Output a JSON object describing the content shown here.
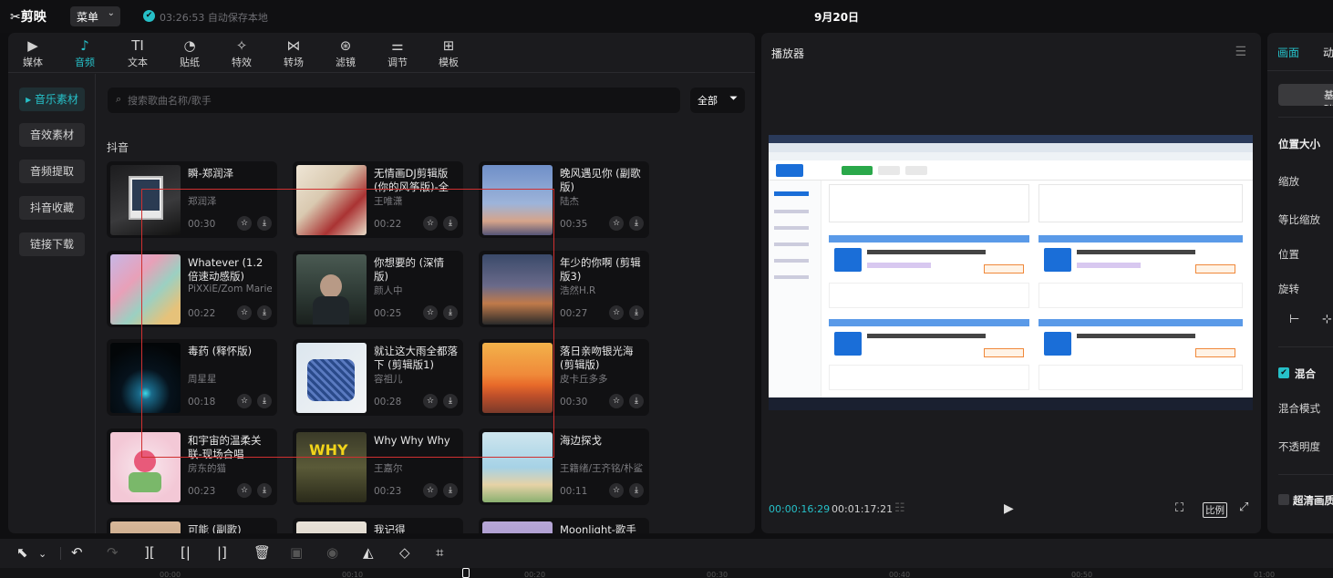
{
  "app": {
    "logo": "✂剪映",
    "menu_label": "菜单",
    "save_icon": "✔",
    "save_status": "03:26:53 自动保存本地",
    "project_title": "9月20日"
  },
  "media_tabs": [
    {
      "icon": "▶",
      "label": "媒体"
    },
    {
      "icon": "♪",
      "label": "音频"
    },
    {
      "icon": "TI",
      "label": "文本"
    },
    {
      "icon": "◔",
      "label": "贴纸"
    },
    {
      "icon": "✧",
      "label": "特效"
    },
    {
      "icon": "⋈",
      "label": "转场"
    },
    {
      "icon": "⊛",
      "label": "滤镜"
    },
    {
      "icon": "⚌",
      "label": "调节"
    },
    {
      "icon": "⊞",
      "label": "模板"
    }
  ],
  "sidebar": [
    "▸ 音乐素材",
    "音效素材",
    "音频提取",
    "抖音收藏",
    "链接下载"
  ],
  "search": {
    "placeholder": "搜索歌曲名称/歌手",
    "filter_label": "全部"
  },
  "section_title": "抖音",
  "songs": [
    {
      "title": "瞬-郑润泽",
      "artist": "郑润泽",
      "duration": "00:30"
    },
    {
      "title": "无情画DJ剪辑版 (你的风筝版)-全网可听",
      "artist": "王唯潇",
      "duration": "00:22"
    },
    {
      "title": "晚风遇见你 (副歌版)",
      "artist": "陆杰",
      "duration": "00:35"
    },
    {
      "title": "Whatever (1.2倍速动感版)",
      "artist": "PiXXiE/Zom Marie",
      "duration": "00:22"
    },
    {
      "title": "你想要的 (深情版)",
      "artist": "颜人中",
      "duration": "00:25"
    },
    {
      "title": "年少的你啊 (剪辑版3)",
      "artist": "浩然H.R",
      "duration": "00:27"
    },
    {
      "title": "毒药 (释怀版)",
      "artist": "周星星",
      "duration": "00:18"
    },
    {
      "title": "就让这大雨全都落下 (剪辑版1)",
      "artist": "容祖儿",
      "duration": "00:28"
    },
    {
      "title": "落日亲吻银光海(剪辑版)",
      "artist": "皮卡丘多多",
      "duration": "00:30"
    },
    {
      "title": "和宇宙的温柔关联-现场合唱",
      "artist": "房东的猫",
      "duration": "00:23"
    },
    {
      "title": "Why Why Why",
      "artist": "王嘉尔",
      "duration": "00:23"
    },
    {
      "title": "海边探戈",
      "artist": "王籍绪/王齐铭/朴鲨",
      "duration": "00:11"
    },
    {
      "title": "可能 (副歌)",
      "artist": "",
      "duration": ""
    },
    {
      "title": "我记得",
      "artist": "",
      "duration": ""
    },
    {
      "title": "Moonlight-歌手叁",
      "artist": "",
      "duration": ""
    }
  ],
  "player": {
    "title": "播放器",
    "current_time": "00:00:16:29",
    "total_time": "00:01:17:21",
    "ratio_label": "比例"
  },
  "right_panel": {
    "tab_picture": "画面",
    "tab_anim": "动画",
    "basic_label": "基础",
    "pos_size": "位置大小",
    "scale": "缩放",
    "uniform_scale": "等比缩放",
    "position": "位置",
    "rotate": "旋转",
    "blend": "混合",
    "blend_mode": "混合模式",
    "opacity": "不透明度",
    "hd": "超清画质"
  },
  "timeline_ticks": [
    "00:00",
    "00:10",
    "00:20",
    "00:30",
    "00:40",
    "00:50",
    "01:00"
  ],
  "colors": {
    "accent": "#26c0c8",
    "highlight_box": "#d03030"
  }
}
